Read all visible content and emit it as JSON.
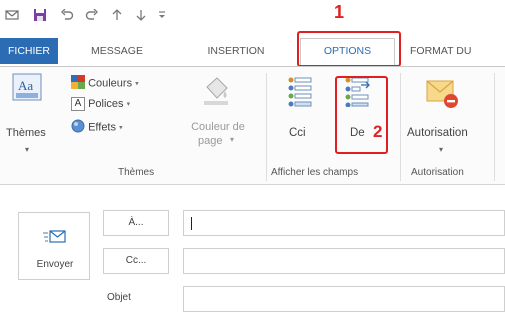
{
  "qat": {
    "icons": [
      "email-icon",
      "save-icon",
      "undo-icon",
      "redo-icon",
      "up-arrow-icon",
      "down-arrow-icon",
      "customize-dropdown-icon"
    ],
    "annotation_1": "1"
  },
  "tabs": [
    {
      "label": "FICHIER"
    },
    {
      "label": "MESSAGE"
    },
    {
      "label": "INSERTION"
    },
    {
      "label": "OPTIONS"
    },
    {
      "label": "FORMAT DU"
    }
  ],
  "ribbon": {
    "themes": {
      "label": "Thèmes",
      "colors_label": "Couleurs",
      "fonts_label": "Polices",
      "effects_label": "Effets",
      "page_color_label": "Couleur de",
      "page_color_label2": "page",
      "group_label": "Thèmes"
    },
    "fields": {
      "bcc_label": "Cci",
      "from_label": "De",
      "annotation_2": "2",
      "group_label": "Afficher les champs"
    },
    "permission": {
      "label": "Autorisation",
      "group_label": "Autorisation"
    }
  },
  "compose": {
    "send_label": "Envoyer",
    "to_label": "À...",
    "cc_label": "Cc...",
    "subject_label": "Objet",
    "to_value": "",
    "cc_value": "",
    "subject_value": ""
  },
  "colors": {
    "accent": "#2b6cb5",
    "annotation": "#e02020"
  }
}
